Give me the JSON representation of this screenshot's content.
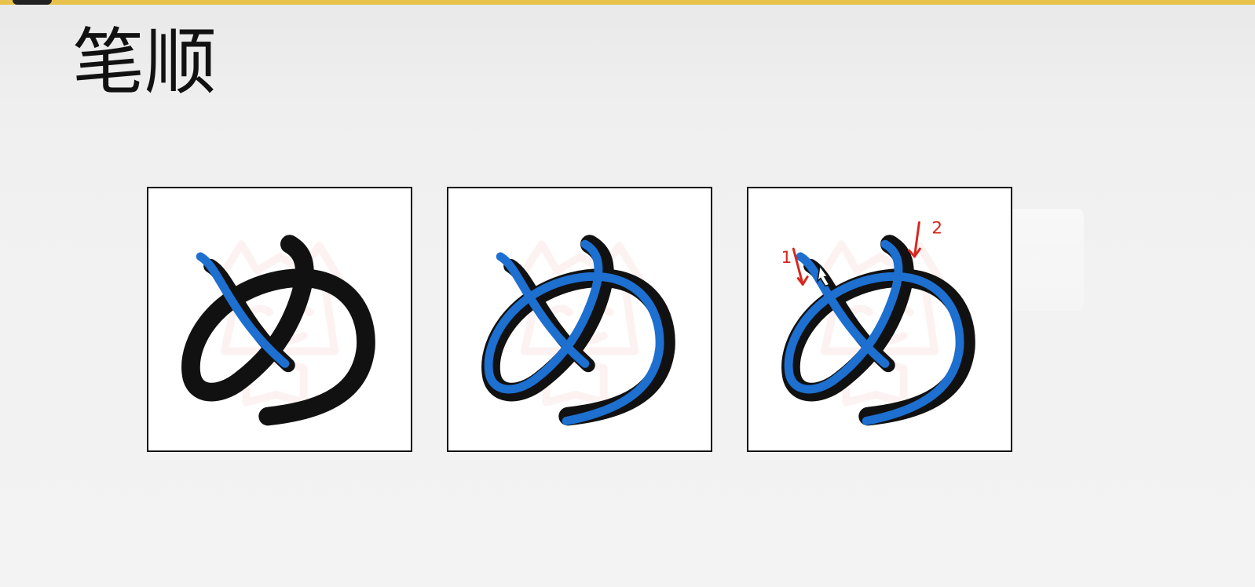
{
  "page": {
    "title": "笔顺"
  },
  "colors": {
    "top_accent": "#e8c24a",
    "stroke_highlight": "#1d6fd0",
    "annotation": "#d7261e",
    "glyph": "#111111"
  },
  "panels": [
    {
      "glyph_annotations": []
    },
    {
      "glyph_annotations": []
    },
    {
      "glyph_annotations": [
        "1",
        "2"
      ]
    }
  ],
  "icons": {
    "annotation_arrow": "arrow-icon",
    "cursor": "cursor-icon",
    "watermark": "watermark-icon"
  }
}
